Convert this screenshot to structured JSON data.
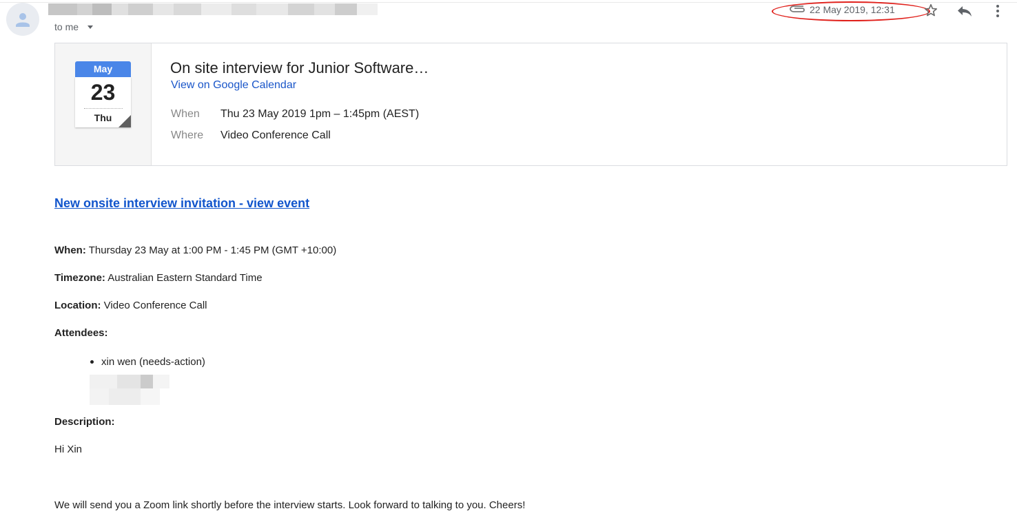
{
  "header": {
    "recipient_label": "to me",
    "date_time": "22 May 2019, 12:31",
    "icons": [
      "avatar-icon",
      "attachment-icon",
      "star-icon",
      "reply-icon",
      "more-vert-icon",
      "chevron-down-icon"
    ]
  },
  "event_card": {
    "month": "May",
    "day": "23",
    "weekday": "Thu",
    "title": "On site interview for Junior Software…",
    "calendar_link": "View on Google Calendar",
    "when_label": "When",
    "when_value": "Thu 23 May 2019 1pm – 1:45pm (AEST)",
    "where_label": "Where",
    "where_value": "Video Conference Call"
  },
  "body": {
    "invite_link": "New onsite interview invitation - view event",
    "when_label": "When:",
    "when_value": "Thursday 23 May at 1:00 PM - 1:45 PM (GMT +10:00)",
    "timezone_label": "Timezone:",
    "timezone_value": "Australian Eastern Standard Time",
    "location_label": "Location:",
    "location_value": "Video Conference Call",
    "attendees_label": "Attendees:",
    "attendees": [
      "xin wen (needs-action)"
    ],
    "description_label": "Description:",
    "greeting": "Hi Xin",
    "message": "We will send you a Zoom link shortly before the interview starts. Look forward to talking to you. Cheers!"
  },
  "colors": {
    "link_blue": "#1155cc",
    "calendar_blue": "#4a86e8",
    "highlight_red": "#e0201b",
    "muted_gray": "#5f6368"
  }
}
